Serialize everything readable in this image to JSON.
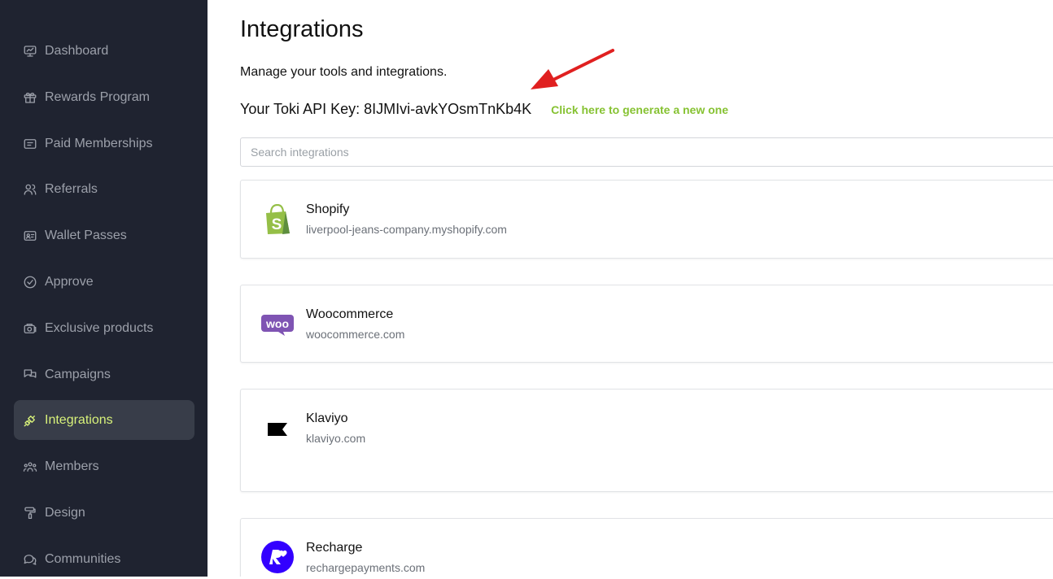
{
  "sidebar": {
    "items": [
      {
        "label": "Dashboard",
        "icon": "monitor-icon"
      },
      {
        "label": "Rewards Program",
        "icon": "gift-icon"
      },
      {
        "label": "Paid Memberships",
        "icon": "card-icon"
      },
      {
        "label": "Referrals",
        "icon": "users-icon"
      },
      {
        "label": "Wallet Passes",
        "icon": "id-card-icon"
      },
      {
        "label": "Approve",
        "icon": "check-circle-icon"
      },
      {
        "label": "Exclusive products",
        "icon": "camera-icon"
      },
      {
        "label": "Campaigns",
        "icon": "chat-icon"
      },
      {
        "label": "Integrations",
        "icon": "plug-icon",
        "active": true
      },
      {
        "label": "Members",
        "icon": "group-icon"
      },
      {
        "label": "Design",
        "icon": "paint-roller-icon"
      },
      {
        "label": "Communities",
        "icon": "chats-icon"
      }
    ],
    "active_color": "#d8f27a",
    "background": "#1f2330"
  },
  "main": {
    "title": "Integrations",
    "subtitle": "Manage your tools and integrations.",
    "api_key_label": "Your Toki API Key:",
    "api_key_value": "8IJMIvi-avkYOsmTnKb4K",
    "generate_link": "Click here to generate a new one",
    "search_placeholder": "Search integrations",
    "accent_color": "#86c232",
    "integrations": [
      {
        "name": "Shopify",
        "domain": "liverpool-jeans-company.myshopify.com",
        "logo": "shopify-logo"
      },
      {
        "name": "Woocommerce",
        "domain": "woocommerce.com",
        "logo": "woocommerce-logo"
      },
      {
        "name": "Klaviyo",
        "domain": "klaviyo.com",
        "logo": "klaviyo-logo"
      },
      {
        "name": "Recharge",
        "domain": "rechargepayments.com",
        "logo": "recharge-logo"
      }
    ]
  }
}
